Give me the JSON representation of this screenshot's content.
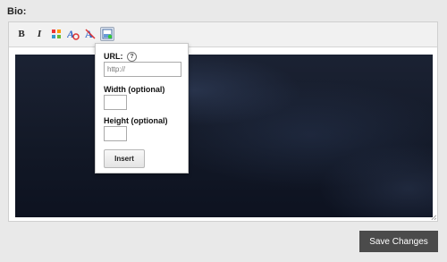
{
  "form": {
    "bio_label": "Bio:"
  },
  "toolbar": {
    "bold": "B",
    "italic": "I",
    "buttons": [
      "bold-icon",
      "italic-icon",
      "color-picker-icon",
      "font-icon",
      "clear-format-icon",
      "insert-image-icon"
    ]
  },
  "image_popup": {
    "url_label": "URL:",
    "help_icon": "?",
    "url_placeholder": "http://",
    "width_label": "Width (optional)",
    "height_label": "Height (optional)",
    "insert_label": "Insert"
  },
  "footer": {
    "save_label": "Save Changes"
  },
  "colors": {
    "save_button": "#4b4b4b",
    "editor_bg": "#1b2233"
  }
}
